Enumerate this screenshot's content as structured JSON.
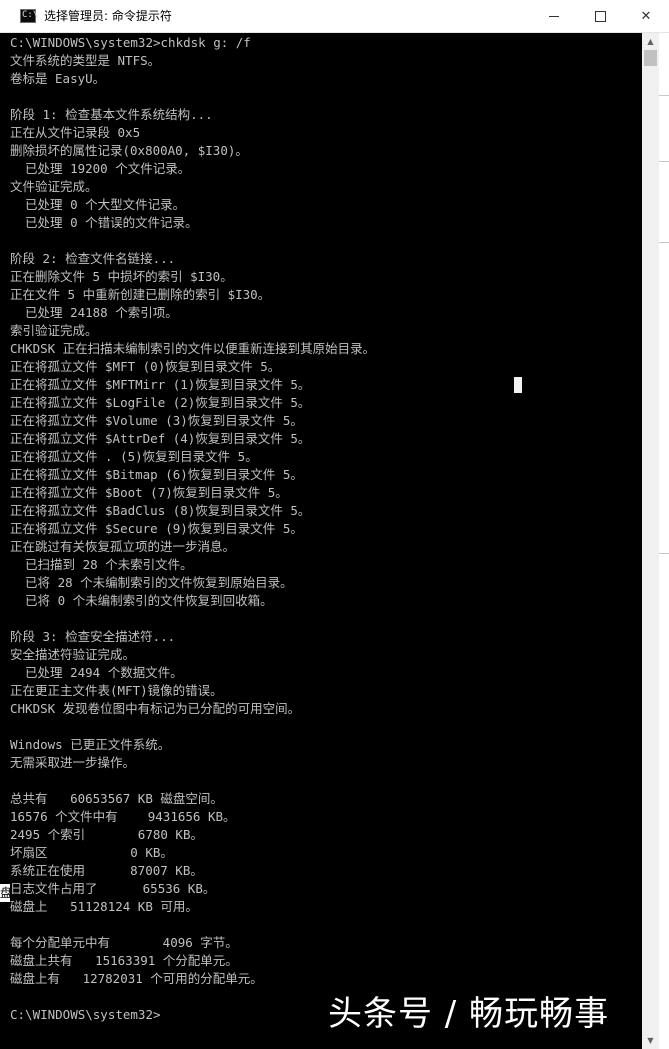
{
  "window": {
    "title": "选择管理员: 命令提示符",
    "icon": "cmd-icon",
    "icon_glyph": "C:\\"
  },
  "console": {
    "lines": [
      "C:\\WINDOWS\\system32>chkdsk g: /f",
      "文件系统的类型是 NTFS。",
      "卷标是 EasyU。",
      "",
      "阶段 1: 检查基本文件系统结构...",
      "正在从文件记录段 0x5",
      "删除损坏的属性记录(0x800A0, $I30)。",
      "  已处理 19200 个文件记录。",
      "文件验证完成。",
      "  已处理 0 个大型文件记录。",
      "  已处理 0 个错误的文件记录。",
      "",
      "阶段 2: 检查文件名链接...",
      "正在删除文件 5 中损坏的索引 $I30。",
      "正在文件 5 中重新创建已删除的索引 $I30。",
      "  已处理 24188 个索引项。",
      "索引验证完成。",
      "CHKDSK 正在扫描未编制索引的文件以便重新连接到其原始目录。",
      "正在将孤立文件 $MFT (0)恢复到目录文件 5。",
      "正在将孤立文件 $MFTMirr (1)恢复到目录文件 5。",
      "正在将孤立文件 $LogFile (2)恢复到目录文件 5。",
      "正在将孤立文件 $Volume (3)恢复到目录文件 5。",
      "正在将孤立文件 $AttrDef (4)恢复到目录文件 5。",
      "正在将孤立文件 . (5)恢复到目录文件 5。",
      "正在将孤立文件 $Bitmap (6)恢复到目录文件 5。",
      "正在将孤立文件 $Boot (7)恢复到目录文件 5。",
      "正在将孤立文件 $BadClus (8)恢复到目录文件 5。",
      "正在将孤立文件 $Secure (9)恢复到目录文件 5。",
      "正在跳过有关恢复孤立项的进一步消息。",
      "  已扫描到 28 个未索引文件。",
      "  已将 28 个未编制索引的文件恢复到原始目录。",
      "  已将 0 个未编制索引的文件恢复到回收箱。",
      "",
      "阶段 3: 检查安全描述符...",
      "安全描述符验证完成。",
      "  已处理 2494 个数据文件。",
      "正在更正主文件表(MFT)镜像的错误。",
      "CHKDSK 发现卷位图中有标记为已分配的可用空间。",
      "",
      "Windows 已更正文件系统。",
      "无需采取进一步操作。",
      "",
      "总共有   60653567 KB 磁盘空间。",
      "16576 个文件中有    9431656 KB。",
      "2495 个索引       6780 KB。",
      "坏扇区           0 KB。",
      "系统正在使用      87007 KB。",
      "日志文件占用了      65536 KB。",
      "磁盘上   51128124 KB 可用。",
      "",
      "每个分配单元中有       4096 字节。",
      "磁盘上共有   15163391 个分配单元。",
      "磁盘上有   12782031 个可用的分配单元。",
      "",
      "C:\\WINDOWS\\system32>"
    ]
  },
  "background_edge_char": "盘",
  "watermark": "头条号 / 畅玩畅事",
  "colors": {
    "console_bg": "#000000",
    "console_text": "#c0c0c0",
    "titlebar_bg": "#ffffff",
    "scrollbar_bg": "#f0f0f0"
  }
}
